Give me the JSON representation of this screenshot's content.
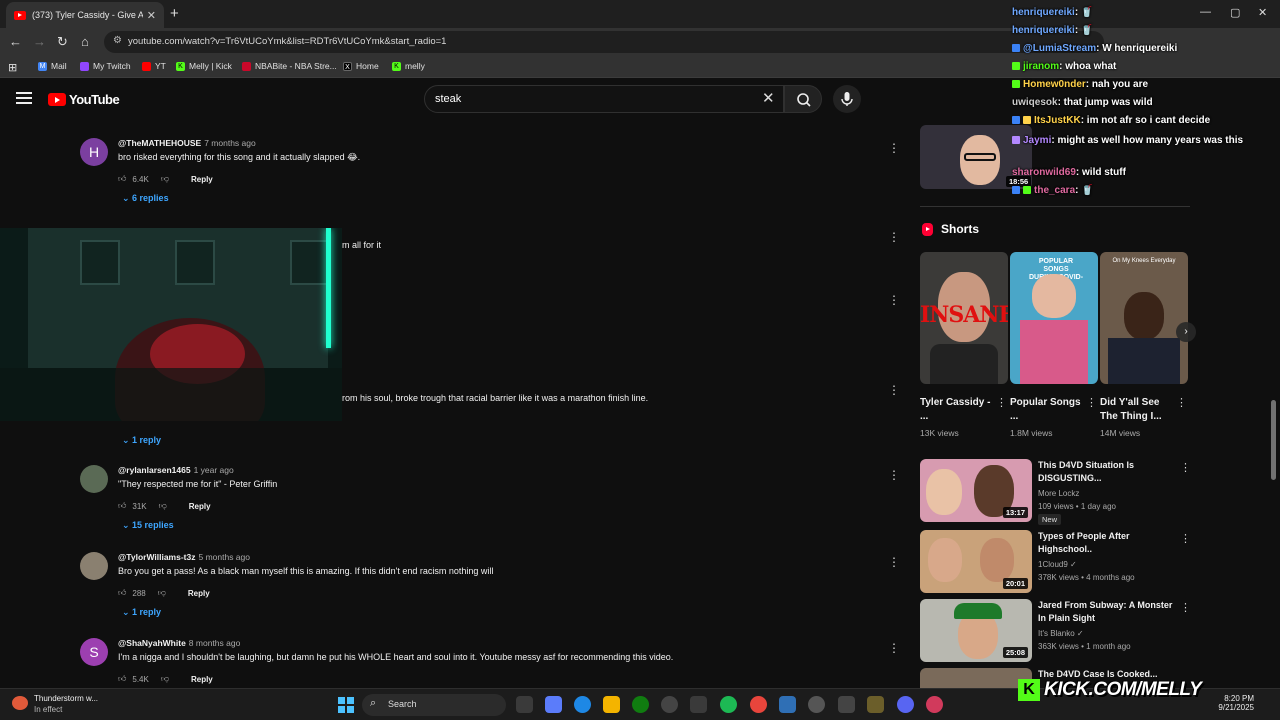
{
  "browser": {
    "tab_title": "(373) Tyler Cassidy - Give A N...",
    "url": "youtube.com/watch?v=Tr6VtUCoYmk&list=RDTr6VtUCoYmk&start_radio=1",
    "bookmarks": [
      {
        "label": "Mail",
        "icon": "mail-icon",
        "color": "#4285f4"
      },
      {
        "label": "My Twitch",
        "icon": "twitch-icon",
        "color": "#9146ff"
      },
      {
        "label": "YT",
        "icon": "youtube-icon",
        "color": "#ff0000"
      },
      {
        "label": "Melly | Kick",
        "icon": "kick-icon",
        "color": "#53fc18"
      },
      {
        "label": "NBABite - NBA Stre...",
        "icon": "nba-icon",
        "color": "#c9082a"
      },
      {
        "label": "Home",
        "icon": "x-icon",
        "color": "#000000"
      },
      {
        "label": "melly",
        "icon": "kick-icon",
        "color": "#53fc18"
      }
    ]
  },
  "youtube": {
    "logo_text": "YouTube",
    "search_value": "steak"
  },
  "comments": [
    {
      "author": "@TheMATHEHOUSE",
      "time": "7 months ago",
      "text": "bro risked everything for this song and it actually slapped 😂.",
      "likes": "6.4K",
      "reply_label": "Reply",
      "replies": "6 replies",
      "avatar_letter": "H",
      "avatar_color": "#7b3fa0"
    },
    {
      "partial_text": "m all for it"
    },
    {
      "partial_text": "rom his soul, broke trough that racial barrier like it was a marathon finish line.",
      "replies": "1 reply"
    },
    {
      "author": "@rylanlarsen1465",
      "time": "1 year ago",
      "text": "\"They respected me for it\" - Peter Griffin",
      "likes": "31K",
      "reply_label": "Reply",
      "replies": "15 replies",
      "avatar_letter": "",
      "avatar_color": "#5a6a55"
    },
    {
      "author": "@TylorWilliams-t3z",
      "time": "5 months ago",
      "text": "Bro you get a pass! As a black man myself this is amazing. If this didn't end racism nothing will",
      "likes": "288",
      "reply_label": "Reply",
      "replies": "1 reply",
      "avatar_letter": "",
      "avatar_color": "#8a8070"
    },
    {
      "author": "@ShaNyahWhite",
      "time": "8 months ago",
      "text": "I'm a nigga and I shouldn't be laughing, but damn he put his WHOLE heart and soul into it. Youtube messy asf for recommending this video.",
      "likes": "5.4K",
      "reply_label": "Reply",
      "avatar_letter": "S",
      "avatar_color": "#9c3fb0"
    }
  ],
  "sidebar": {
    "top_duration": "18:56",
    "shorts_heading": "Shorts",
    "shorts": [
      {
        "title": "Tyler Cassidy - ...",
        "views": "13K views"
      },
      {
        "title": "Popular Songs ...",
        "views": "1.8M views"
      },
      {
        "title": "Did Y'all See The Thing I...",
        "views": "14M views"
      }
    ],
    "videos": [
      {
        "title": "This D4VD Situation Is DISGUSTING...",
        "channel": "More Lockz",
        "stats": "109 views • 1 day ago",
        "badge": "New",
        "duration": "13:17"
      },
      {
        "title": "Types of People After Highschool..",
        "channel": "1Cloud9 ✓",
        "stats": "378K views • 4 months ago",
        "duration": "20:01"
      },
      {
        "title": "Jared From Subway: A Monster In Plain Sight",
        "channel": "It's Blanko ✓",
        "stats": "363K views • 1 month ago",
        "duration": "25:08"
      },
      {
        "title": "The D4VD Case Is Cooked...",
        "channel": "",
        "stats": "",
        "duration": ""
      }
    ]
  },
  "chat": [
    {
      "user": "henriquereiki",
      "message": ": 🥤",
      "color": "#6fa8ff"
    },
    {
      "user": "henriquereiki",
      "message": ": 🥤",
      "color": "#6fa8ff"
    },
    {
      "user": "@LumiaStream",
      "message": ": W henriquereiki",
      "color": "#6fa8ff"
    },
    {
      "user": "jiranom",
      "message": ": whoa what",
      "color": "#53fc18"
    },
    {
      "user": "Homew0nder",
      "message": ": nah you are",
      "color": "#ffd24a"
    },
    {
      "user": "uwiqesok",
      "message": ": that jump was wild",
      "color": "#cccccc"
    },
    {
      "user": "ItsJustKK",
      "message": ": im not afr so i cant decide",
      "color": "#ffd24a"
    },
    {
      "user": "Jaymi",
      "message": ": might as well how many years was this",
      "color": "#b388ff"
    },
    {
      "user": "sharonwild69",
      "message": ": wild stuff",
      "color": "#e06aa0"
    },
    {
      "user": "the_cara",
      "message": ": 🥤",
      "color": "#e06aa0"
    }
  ],
  "overlay": {
    "kick_url": "KICK.COM/MELLY",
    "kick_letter": "K"
  },
  "taskbar": {
    "weather_title": "Thunderstorm w...",
    "weather_sub": "In effect",
    "search_label": "Search",
    "time": "8:20 PM",
    "date": "9/21/2025"
  }
}
